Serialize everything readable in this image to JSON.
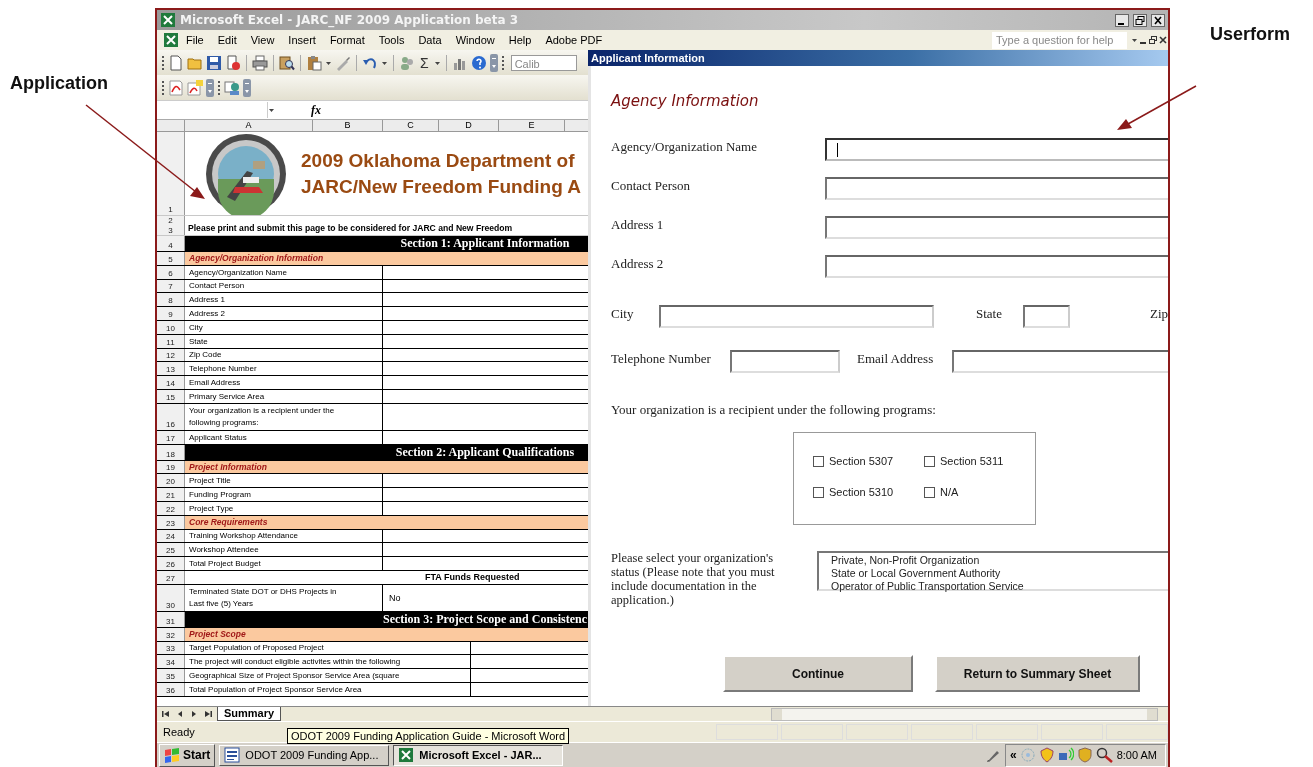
{
  "annotations": [
    {
      "text": "Application"
    },
    {
      "text": "Userform"
    }
  ],
  "excel": {
    "title": "Microsoft Excel - JARC_NF 2009 Application beta 3",
    "menu": [
      "File",
      "Edit",
      "View",
      "Insert",
      "Format",
      "Tools",
      "Data",
      "Window",
      "Help",
      "Adobe PDF"
    ],
    "help_box": {
      "placeholder": "Type a question for help"
    },
    "toolbar": {
      "sum_label": "Σ",
      "font_box": "Calib"
    },
    "formula_bar": {
      "fx_label": "fx"
    },
    "columns": [
      "A",
      "B",
      "C",
      "D",
      "E"
    ],
    "rows": [
      {
        "nums": [
          "1"
        ],
        "kind": "banner",
        "lines": [
          "2009 Oklahoma Department of",
          "JARC/New Freedom Funding A"
        ]
      },
      {
        "nums": [
          "2",
          "3"
        ],
        "kind": "note",
        "text": "Please print and submit this page to be considered for JARC and New Freedom"
      },
      {
        "nums": [
          "4"
        ],
        "kind": "section",
        "text": "Section 1: Applicant Information"
      },
      {
        "nums": [
          "5"
        ],
        "kind": "group",
        "text": "Agency/Organization Information"
      },
      {
        "nums": [
          "6"
        ],
        "kind": "field",
        "text": "Agency/Organization Name"
      },
      {
        "nums": [
          "7"
        ],
        "kind": "field",
        "text": "Contact Person"
      },
      {
        "nums": [
          "8"
        ],
        "kind": "field",
        "text": "Address 1"
      },
      {
        "nums": [
          "9"
        ],
        "kind": "field",
        "text": "Address 2"
      },
      {
        "nums": [
          "10"
        ],
        "kind": "field",
        "text": "City"
      },
      {
        "nums": [
          "11"
        ],
        "kind": "field",
        "text": "State"
      },
      {
        "nums": [
          "12"
        ],
        "kind": "field",
        "text": "Zip Code"
      },
      {
        "nums": [
          "13"
        ],
        "kind": "field",
        "text": "Telephone Number"
      },
      {
        "nums": [
          "14"
        ],
        "kind": "field",
        "text": "Email Address"
      },
      {
        "nums": [
          "15"
        ],
        "kind": "field",
        "text": "Primary Service Area"
      },
      {
        "nums": [
          "16"
        ],
        "kind": "field",
        "text": "Your organization is a recipient under the following programs:"
      },
      {
        "nums": [
          "17"
        ],
        "kind": "field",
        "text": "Applicant Status"
      },
      {
        "nums": [
          "18"
        ],
        "kind": "section",
        "text": "Section 2: Applicant Qualifications"
      },
      {
        "nums": [
          "19"
        ],
        "kind": "group",
        "text": "Project Information"
      },
      {
        "nums": [
          "20"
        ],
        "kind": "field",
        "text": "Project Title"
      },
      {
        "nums": [
          "21"
        ],
        "kind": "field",
        "text": "Funding Program"
      },
      {
        "nums": [
          "22"
        ],
        "kind": "field",
        "text": "Project Type"
      },
      {
        "nums": [
          "23"
        ],
        "kind": "group",
        "text": "Core Requirements"
      },
      {
        "nums": [
          "24"
        ],
        "kind": "field",
        "text": "Training Workshop Attendance"
      },
      {
        "nums": [
          "25"
        ],
        "kind": "field",
        "text": "Workshop Attendee"
      },
      {
        "nums": [
          "26"
        ],
        "kind": "field",
        "text": "Total Project Budget"
      },
      {
        "nums": [
          "27"
        ],
        "kind": "heading",
        "text": "FTA Funds Requested"
      },
      {
        "nums": [
          "30"
        ],
        "kind": "field",
        "text": "Terminated State DOT or DHS Projects in Last five (5) Years",
        "value": "No"
      },
      {
        "nums": [
          "31"
        ],
        "kind": "section",
        "text": "Section 3: Project Scope and Consistenc"
      },
      {
        "nums": [
          "32"
        ],
        "kind": "group",
        "text": "Project Scope"
      },
      {
        "nums": [
          "33"
        ],
        "kind": "wide",
        "text": "Target Population of Proposed Project"
      },
      {
        "nums": [
          "34"
        ],
        "kind": "wide",
        "text": "The project will conduct eligible activites within the following"
      },
      {
        "nums": [
          "35"
        ],
        "kind": "wide",
        "text": "Geographical Size of Project Sponsor Service Area (square"
      },
      {
        "nums": [
          "36"
        ],
        "kind": "wide",
        "text": "Total Population of Project Sponsor Service Area"
      }
    ],
    "sheet_tabs": [
      {
        "label": "Summary",
        "selected": true
      }
    ],
    "status": "Ready",
    "tooltip": "ODOT 2009 Funding Application Guide - Microsoft Word"
  },
  "userform": {
    "title": "Applicant Information",
    "heading": "Agency Information",
    "full_rows": [
      {
        "label": "Agency/Organization Name",
        "focused": true
      },
      {
        "label": "Contact Person",
        "focused": false
      },
      {
        "label": "Address 1",
        "focused": false
      },
      {
        "label": "Address 2",
        "focused": false
      }
    ],
    "city_row": [
      {
        "label": "City",
        "kind": "wide"
      },
      {
        "label": "State",
        "kind": "short"
      },
      {
        "label": "Zip",
        "kind": "label"
      }
    ],
    "contact_row": [
      {
        "label": "Telephone Number",
        "kind": "medium"
      },
      {
        "label": "Email Address",
        "kind": "long"
      }
    ],
    "programs_prompt": "Your organization is a recipient under the following programs:",
    "programs": [
      {
        "label": "Section 5307",
        "checked": false
      },
      {
        "label": "Section 5311",
        "checked": false
      },
      {
        "label": "Section 5310",
        "checked": false
      },
      {
        "label": "N/A",
        "checked": false
      }
    ],
    "status_prompt": "Please select your organization's status (Please note that you must include documentation in the application.)",
    "status_options": [
      {
        "label": "Private, Non-Profit Organization",
        "selected": false
      },
      {
        "label": "State or Local Government Authority",
        "selected": false
      },
      {
        "label": "Operator of Public Transportation Service",
        "selected": false
      }
    ],
    "buttons": [
      "Continue",
      "Return to Summary Sheet"
    ]
  },
  "taskbar": {
    "start": "Start",
    "tasks": [
      {
        "label": "ODOT 2009 Funding App...",
        "kind": "word",
        "selected": false
      },
      {
        "label": "Microsoft Excel - JAR...",
        "kind": "excel",
        "selected": true
      }
    ],
    "tray_expand": "«",
    "clock": "8:00 AM"
  }
}
